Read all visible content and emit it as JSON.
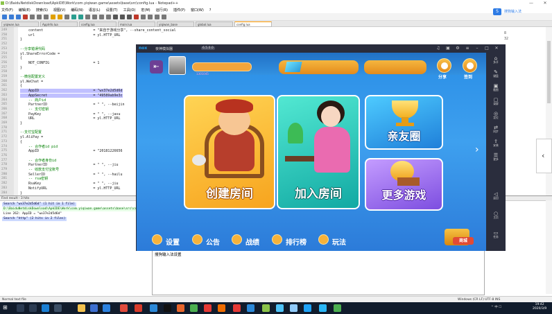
{
  "notepad": {
    "title": "D:\\BaiduNetdiskDownload\\ApkIDE\\Work\\com.yiqiwan.game\\assets\\base\\src\\config.lua - Notepad++",
    "menu": [
      "文件(F)",
      "编辑(E)",
      "搜索(S)",
      "视图(V)",
      "编码(N)",
      "语言(L)",
      "设置(T)",
      "工具(O)",
      "宏(M)",
      "运行(R)",
      "插件(P)",
      "窗口(W)",
      "?"
    ],
    "tabs": [
      "yiqiwan.lua",
      "AppInfo.lua",
      "config.lua",
      "main.lua",
      "yiqiwan_base",
      "global.lua",
      "config.lua"
    ],
    "lines": [
      {
        "n": "249",
        "text": "    content                        = \"来自于游戏分享\", --share_content_social"
      },
      {
        "n": "250",
        "text": "    url                            = yl.HTTP_URL"
      },
      {
        "n": "251",
        "text": "}"
      },
      {
        "n": "252",
        "text": ""
      },
      {
        "n": "253",
        "text": "--分享错误代码"
      },
      {
        "n": "254",
        "text": "yl.ShareErrorCode ="
      },
      {
        "n": "255",
        "text": "{"
      },
      {
        "n": "256",
        "text": "    NOT_CONFIG                     = 1"
      },
      {
        "n": "257",
        "text": "}"
      },
      {
        "n": "258",
        "text": ""
      },
      {
        "n": "259",
        "text": "--微信配置定义"
      },
      {
        "n": "260",
        "text": "yl.WeChat ="
      },
      {
        "n": "261",
        "text": "{"
      },
      {
        "n": "262",
        "text": "    AppID                          = \"wx37e2d5d6d"
      },
      {
        "n": "263",
        "text": "    AppSecret                      = \"49589ab9e3c"
      },
      {
        "n": "264",
        "text": "    -- 商户id"
      },
      {
        "n": "265",
        "text": "    PartnerID                      = \" \", --beijin"
      },
      {
        "n": "266",
        "text": "    -- 支付密钥"
      },
      {
        "n": "267",
        "text": "    PayKey                         = \" \", --jasu"
      },
      {
        "n": "268",
        "text": "    URL                            = yl.HTTP_URL"
      },
      {
        "n": "269",
        "text": "}"
      },
      {
        "n": "270",
        "text": ""
      },
      {
        "n": "271",
        "text": "--支付宝配置"
      },
      {
        "n": "272",
        "text": "yl.AliPay ="
      },
      {
        "n": "273",
        "text": "{"
      },
      {
        "n": "274",
        "text": "    -- 合作者id pid"
      },
      {
        "n": "275",
        "text": "    AppID                          = \"20181226656"
      },
      {
        "n": "276",
        "text": ""
      },
      {
        "n": "277",
        "text": "    -- 合作者身份id"
      },
      {
        "n": "278",
        "text": "    PartnerID                      = \" \", --jiu"
      },
      {
        "n": "279",
        "text": "    -- 收款支付宝账号"
      },
      {
        "n": "280",
        "text": "    SellerID                       = \" \", --hailu"
      },
      {
        "n": "281",
        "text": "    -- rsa密钥"
      },
      {
        "n": "282",
        "text": "    RsaKey                         = \" \", --jiu"
      },
      {
        "n": "283",
        "text": "    NotifyURL                      = yl.HTTP_URL"
      },
      {
        "n": "284",
        "text": "}"
      }
    ],
    "right_text": [
      "8",
      "",
      "32"
    ],
    "find_head": "Find result - 3 hits",
    "find": [
      {
        "kind": "srch",
        "text": "Search \"wx37e2d5d6d\" (1 hit in 1 file)"
      },
      {
        "kind": "file",
        "text": "  D:\\BaiduNetdiskDownload\\ApkIDE\\Work\\com.yiqiwan.game\\assets\\base\\src\\config.lua (1 hit)"
      },
      {
        "kind": "plain",
        "text": "    Line 262:     AppID = \"wx37e2d5d6d\""
      },
      {
        "kind": "srch",
        "text": "Search \"http\" (2 hits in 2 files)"
      }
    ],
    "status": {
      "left": "Normal text file",
      "right": "Windows (CR LF)   UTF-8   INS"
    }
  },
  "ime": {
    "label": "搜狗输入法"
  },
  "under": {
    "text": "搜狗输入法设置"
  },
  "nox": {
    "logo": "nox",
    "name": "夜神模拟器",
    "version": "6.5.0.0",
    "sidebar": [
      {
        "icon": "⌂",
        "label": "多开"
      },
      {
        "icon": "✎",
        "label": "键盘"
      },
      {
        "icon": "▣",
        "label": "截图"
      },
      {
        "icon": "▢",
        "label": "录屏"
      },
      {
        "icon": "◎",
        "label": "定位"
      },
      {
        "icon": "⇄",
        "label": "同步"
      },
      {
        "icon": "⇪",
        "label": "安装"
      },
      {
        "icon": "☰",
        "label": "更多"
      },
      {
        "icon": "◁",
        "label": "返回"
      },
      {
        "icon": "○",
        "label": "主页"
      },
      {
        "icon": "▭",
        "label": "任务"
      }
    ]
  },
  "game": {
    "share_label": "分享",
    "checkin_label": "签到",
    "player_text": "1301045",
    "cards": {
      "create": "创建房间",
      "join": "加入房间",
      "friends": "亲友圈",
      "more": "更多游戏"
    },
    "nav": [
      "设置",
      "公告",
      "战绩",
      "排行榜",
      "玩法"
    ],
    "shop": "商城",
    "colors": {
      "sky": "#3ea0ef",
      "gold": "#f6b23a",
      "create": "#f7a41e",
      "join": "#12a9a3",
      "friends": "#1f7fd9",
      "more": "#7d4ee0"
    }
  },
  "taskbar": {
    "start": "⊞",
    "tray": "^ 中 ☐",
    "time": "19:42",
    "date": "2020/3/9"
  }
}
